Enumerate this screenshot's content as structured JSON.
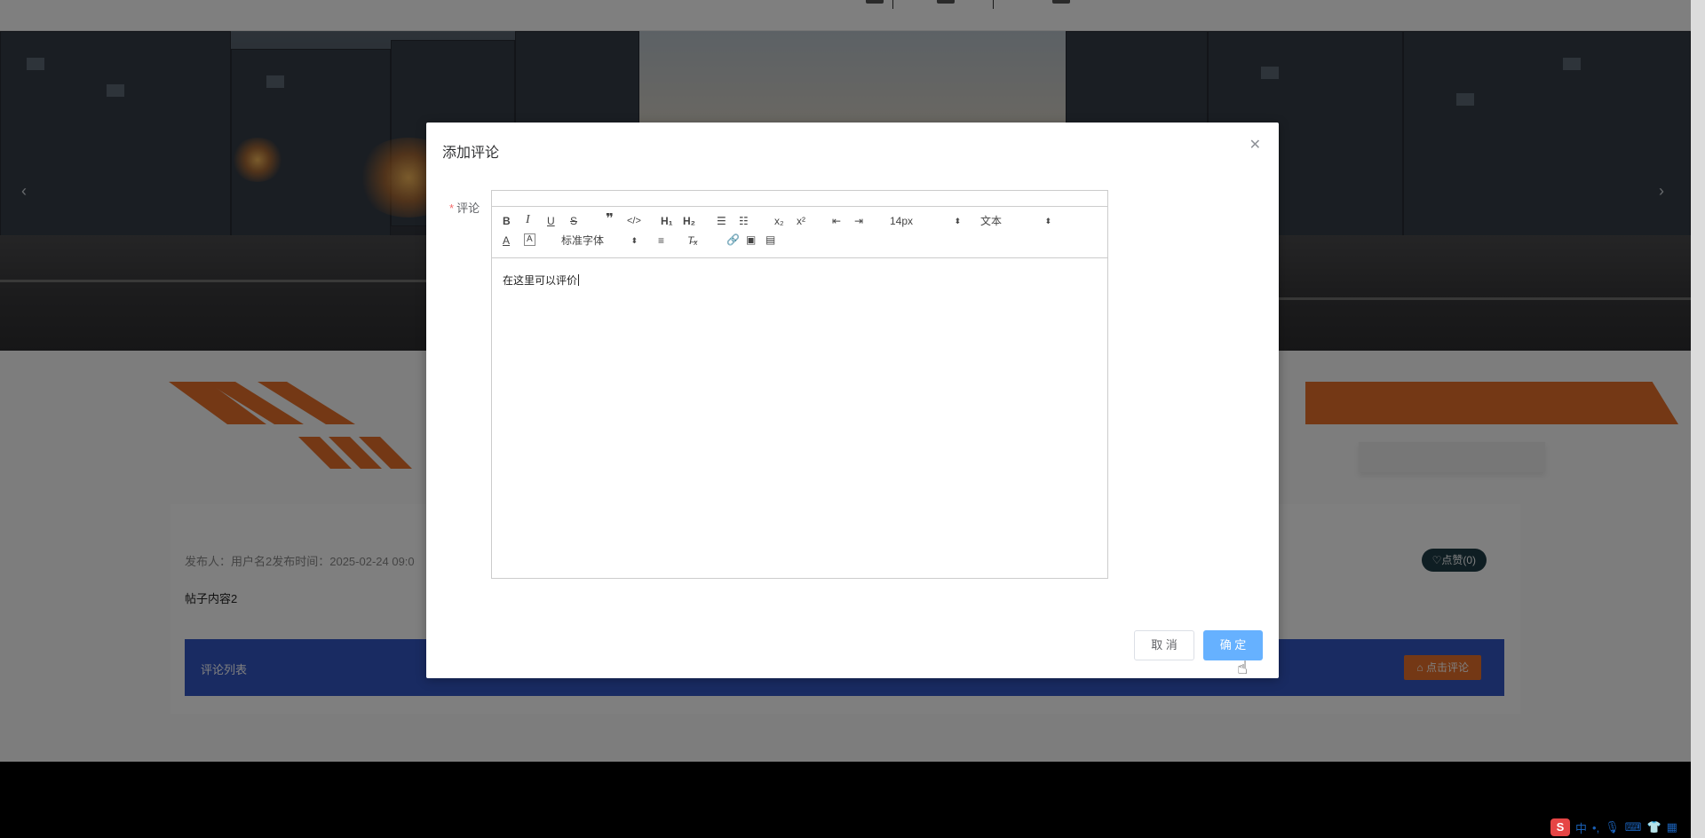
{
  "dialog": {
    "title": "添加评论",
    "close_icon": "close-icon",
    "field_label": "评论",
    "required_mark": "*",
    "editor": {
      "content": "在这里可以评价",
      "font_size": "14px",
      "header_select": "文本",
      "font_family": "标准字体",
      "toolbar": [
        "bold",
        "italic",
        "underline",
        "strike",
        "blockquote",
        "code-block",
        "h1",
        "h2",
        "ordered-list",
        "bullet-list",
        "subscript",
        "superscript",
        "indent-decrease",
        "indent-increase",
        "size",
        "header",
        "font-color",
        "background-color",
        "font",
        "align",
        "clean",
        "link",
        "image",
        "video"
      ]
    },
    "cancel_label": "取 消",
    "ok_label": "确 定"
  },
  "post": {
    "meta": "发布人：用户名2发布时间：2025-02-24 09:0",
    "content": "帖子内容2",
    "like_label": "♡点赞(0)"
  },
  "comments": {
    "title": "评论列表",
    "add_label": "点击评论"
  },
  "ime_tray": {
    "lang": "中",
    "punct": "•,"
  },
  "colors": {
    "accent_orange": "#e8702a",
    "comment_bar_blue": "#3356c4",
    "ok_button": "#66b1ff",
    "like_button": "#1f3c47"
  }
}
